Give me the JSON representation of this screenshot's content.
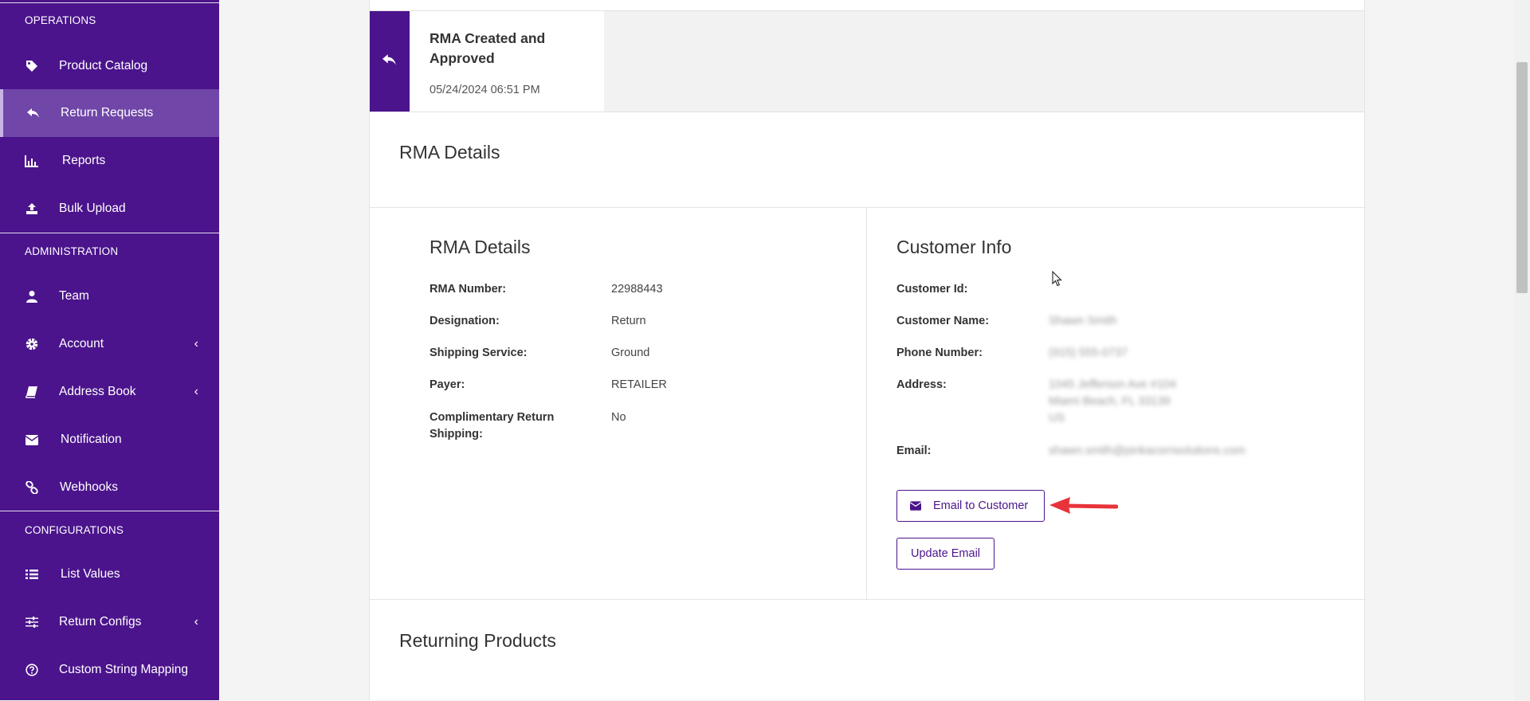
{
  "sidebar": {
    "sections": {
      "operations": "OPERATIONS",
      "administration": "ADMINISTRATION",
      "configurations": "CONFIGURATIONS"
    },
    "items": [
      {
        "label": "Product Catalog",
        "icon": "tag-icon"
      },
      {
        "label": "Return Requests",
        "icon": "reply-icon",
        "active": true
      },
      {
        "label": "Reports",
        "icon": "bar-chart-icon"
      },
      {
        "label": "Bulk Upload",
        "icon": "upload-icon"
      },
      {
        "label": "Team",
        "icon": "user-icon"
      },
      {
        "label": "Account",
        "icon": "gear-icon",
        "chevron": "‹"
      },
      {
        "label": "Address Book",
        "icon": "book-icon",
        "chevron": "‹"
      },
      {
        "label": "Notification",
        "icon": "envelope-icon"
      },
      {
        "label": "Webhooks",
        "icon": "link-icon"
      },
      {
        "label": "List Values",
        "icon": "list-icon"
      },
      {
        "label": "Return Configs",
        "icon": "sliders-icon",
        "chevron": "‹"
      },
      {
        "label": "Custom String Mapping",
        "icon": "question-circle-icon"
      }
    ]
  },
  "timeline": {
    "title": "RMA Created and Approved",
    "date": "05/24/2024 06:51 PM"
  },
  "section_title": "RMA Details",
  "rma_details": {
    "title": "RMA Details",
    "fields": [
      {
        "label": "RMA Number:",
        "value": "22988443"
      },
      {
        "label": "Designation:",
        "value": "Return"
      },
      {
        "label": "Shipping Service:",
        "value": "Ground"
      },
      {
        "label": "Payer:",
        "value": "RETAILER"
      },
      {
        "label": "Complimentary Return Shipping:",
        "value": "No"
      }
    ]
  },
  "customer_info": {
    "title": "Customer Info",
    "fields": [
      {
        "label": "Customer Id:",
        "value": ""
      },
      {
        "label": "Customer Name:",
        "value": "Shawn Smith"
      },
      {
        "label": "Phone Number:",
        "value": "(915) 555-0737"
      },
      {
        "label": "Address:",
        "value_lines": [
          "1045 Jefferson Ave #104",
          "Miami Beach, FL 33139",
          "US"
        ]
      },
      {
        "label": "Email:",
        "value": "shawn.smith@pinkacornsolutions.com"
      }
    ],
    "email_button": "Email to Customer",
    "update_email_button": "Update Email"
  },
  "returning_products_title": "Returning Products",
  "colors": {
    "brand": "#4b148c",
    "sidebar_active": "#7046a8",
    "annotation_arrow": "#e8333a"
  }
}
